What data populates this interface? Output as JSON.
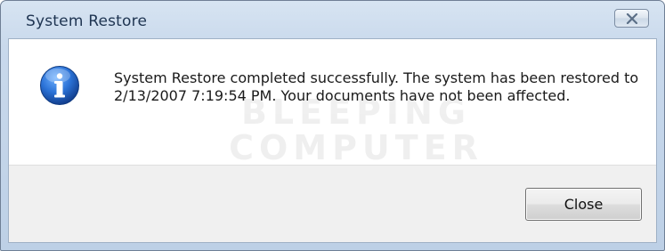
{
  "window": {
    "title": "System Restore",
    "close_icon": "close-icon"
  },
  "dialog": {
    "icon": "info-icon",
    "message": "System Restore completed successfully. The system has been restored to 2/13/2007 7:19:54 PM. Your documents have not been affected.",
    "watermark_line1": "BLEEPING",
    "watermark_line2": "COMPUTER",
    "close_button_label": "Close"
  },
  "colors": {
    "titlebar": "#c9d9ec",
    "message_bg": "#ffffff",
    "footer_bg": "#f0f0f0",
    "icon_blue": "#1f66c4"
  }
}
